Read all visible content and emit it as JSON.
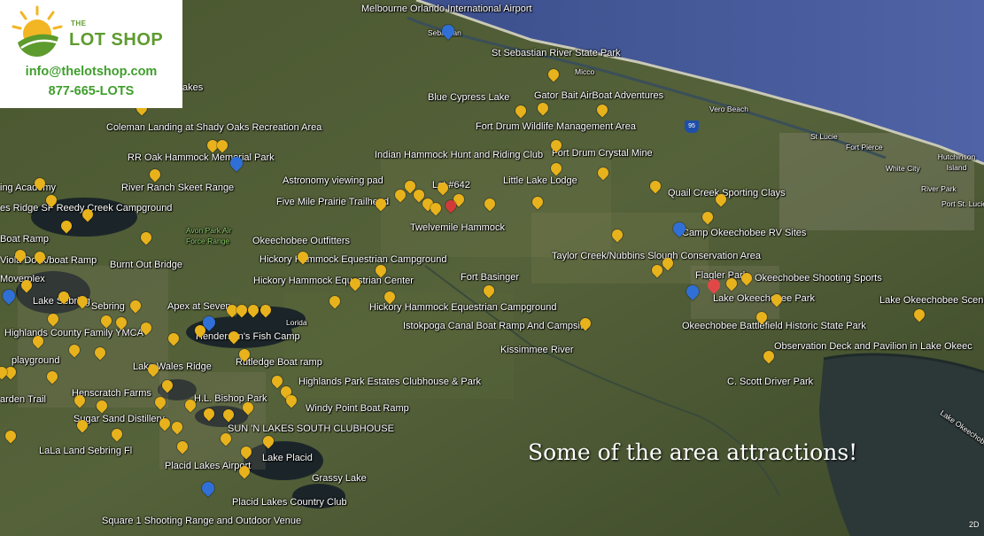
{
  "brand": {
    "small": "THE",
    "name": "LOT SHOP",
    "email": "info@thelotshop.com",
    "phone": "877-665-LOTS"
  },
  "caption": "Some of the area attractions!",
  "view_mode": "2D",
  "highway_shield": "95",
  "labels": [
    "Melbourne Orlando International Airport",
    "Sebastian",
    "St Sebastian River State Park",
    "Micco",
    "Blue Cypress Lake",
    "Gator Bait AirBoat Adventures",
    "Vero Beach",
    "Fort Drum Wildlife Management Area",
    "St Lucie",
    "Fort Pierce",
    "Hutchinson Island",
    "White City",
    "River Park",
    "Port St. Lucie",
    "Coleman Landing at Shady Oaks Recreation Area",
    "RR Oak Hammock Memorial Park",
    "Indian Hammock Hunt and Riding Club",
    "Fort Drum Crystal Mine",
    "Astronomy viewing pad",
    "Little Lake Lodge",
    "ing Academy",
    "River Ranch Skeet Range",
    "Lot #642",
    "Quail Creek Sporting Clays",
    "es Ridge SF Reedy Creek Campground",
    "Five Mile Prairie Trailhead",
    "Twelvemile Hammock",
    "Avon Park Air Force Range",
    "Boat Ramp",
    "Okeechobee Outfitters",
    "Camp Okeechobee RV Sites",
    "Viola Dock/boat Ramp",
    "Taylor Creek/Nubbins Slough Conservation Area",
    "Hickory Hammock Equestrian Campground",
    "Burnt Out Bridge",
    "Flagler Park",
    "Moverplex",
    "Fort Basinger",
    "Okeechobee Shooting Sports",
    "Hickory Hammock Equestrian Center",
    "Lake Okeechobee Scenic Tr",
    "Lake Sebring",
    "Sebring",
    "Lake Okeechobee Park",
    "Apex at Seven",
    "Hickory Hammock Equestrian Campground",
    "Highlands County Family YMCA",
    "Henderson's Fish Camp",
    "Istokpoga Canal Boat Ramp And Campsite",
    "Okeechobee Battlefield Historic State Park",
    "Lorida",
    "playground",
    "Observation Deck and Pavilion in Lake Okeec",
    "Kissimmee River",
    "Lake Wales Ridge",
    "Rutledge Boat ramp",
    "Henscratch Farms",
    "C. Scott Driver Park",
    "arden Trail",
    "Highlands Park Estates Clubhouse & Park",
    "H.L. Bishop Park",
    "Windy Point Boat Ramp",
    "Sugar Sand Distillery",
    "Lake Okeechobee",
    "SUN 'N LAKES SOUTH CLUBHOUSE",
    "LaLa Land Sebring Fl",
    "Lake Placid",
    "Placid Lakes Airport",
    "Grassy Lake",
    "Placid Lakes Country Club",
    "Square 1 Shooting Range and Outdoor Venue",
    "akes"
  ]
}
